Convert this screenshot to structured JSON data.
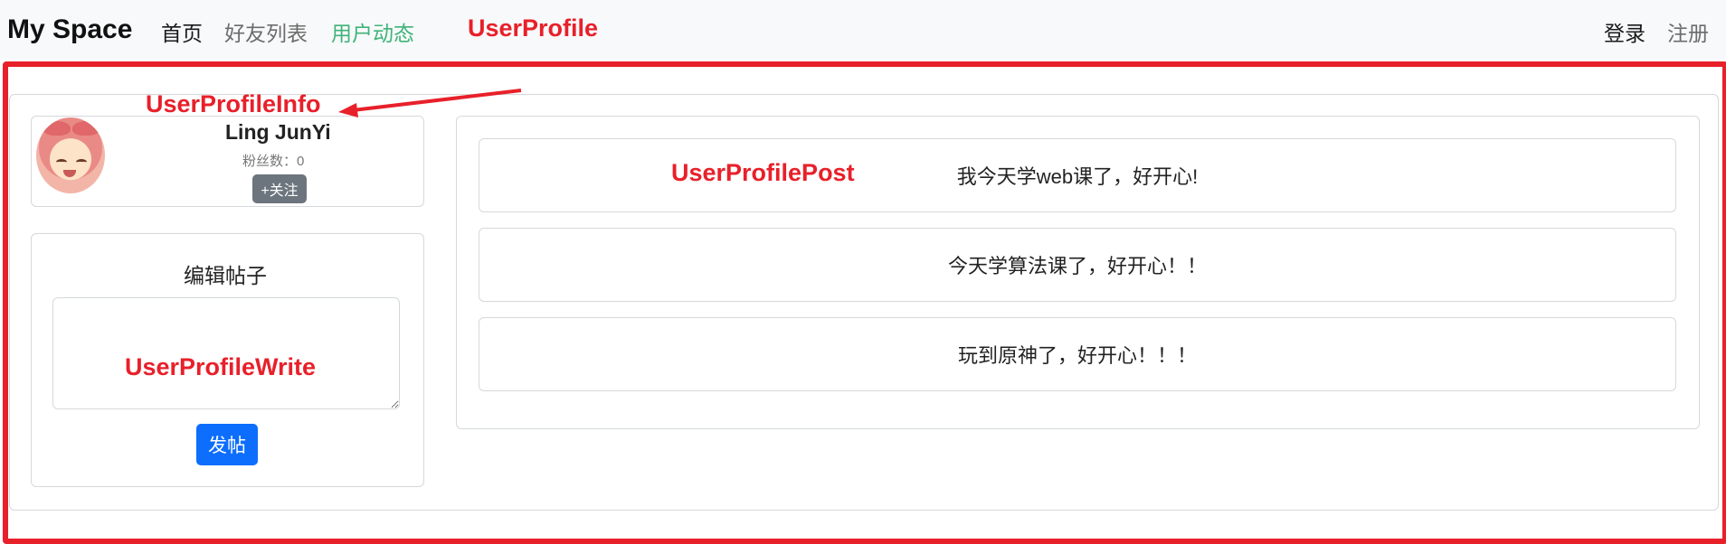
{
  "navbar": {
    "brand": "My Space",
    "links": {
      "home": "首页",
      "friends": "好友列表",
      "status": "用户动态"
    },
    "login": "登录",
    "register": "注册"
  },
  "annotations": {
    "profile": "UserProfile",
    "info": "UserProfileInfo",
    "write": "UserProfileWrite",
    "post": "UserProfilePost",
    "color": "#e8202a"
  },
  "user": {
    "name": "Ling JunYi",
    "fans": "粉丝数：0",
    "follow_label": "+关注"
  },
  "write": {
    "title": "编辑帖子",
    "submit_label": "发帖"
  },
  "posts": [
    {
      "content": "我今天学web课了，好开心!"
    },
    {
      "content": "今天学算法课了，好开心！！"
    },
    {
      "content": "玩到原神了，好开心！！！"
    }
  ],
  "colors": {
    "primary": "#0d6efd",
    "secondary": "#6c757d",
    "active_link": "#3fb47a"
  }
}
